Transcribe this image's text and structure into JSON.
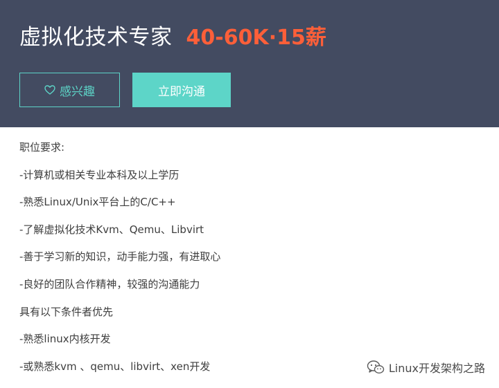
{
  "header": {
    "job_title": "虚拟化技术专家",
    "salary": "40-60K·15薪",
    "interest_button": {
      "icon": "heart-outline-icon",
      "label": "感兴趣"
    },
    "chat_button_label": "立即沟通"
  },
  "description": {
    "lines": [
      "职位要求:",
      "-计算机或相关专业本科及以上学历",
      "-熟悉Linux/Unix平台上的C/C++",
      "-了解虚拟化技术Kvm、Qemu、Libvirt",
      "-善于学习新的知识，动手能力强，有进取心",
      "-良好的团队合作精神，较强的沟通能力",
      "具有以下条件者优先",
      "-熟悉linux内核开发",
      "-或熟悉kvm 、qemu、libvirt、xen开发"
    ]
  },
  "watermark": {
    "icon": "wechat-icon",
    "text": "Linux开发架构之路"
  },
  "colors": {
    "header_bg": "#434b61",
    "accent": "#5dd5c8",
    "salary": "#fd5f39"
  }
}
